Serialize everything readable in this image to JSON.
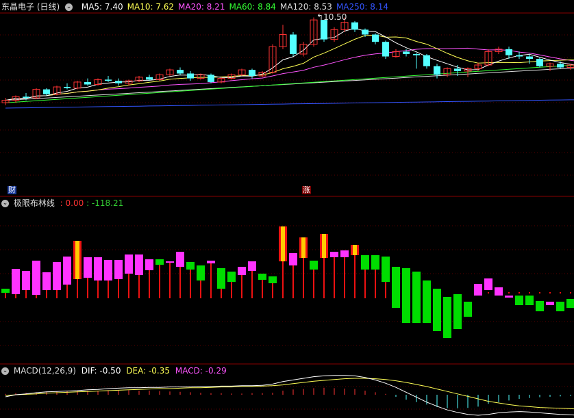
{
  "colors": {
    "background": "#000000",
    "separator": "#8a0000",
    "grid": "#5a0000",
    "up": "#ff3333",
    "down": "#54ffff",
    "ma5": "#ffffff",
    "ma10": "#ffff55",
    "ma20": "#ff55ff",
    "ma60": "#33ff33",
    "ma120": "#dddddd",
    "ma250": "#3355ff",
    "bar_magenta": "#ff33ff",
    "bar_green": "#00dd00",
    "bar_red": "#ee1111",
    "bar_yellow": "#ffcc00",
    "dea": "#ffff55"
  },
  "main_panel": {
    "title": "东晶电子 (日线)",
    "ma": [
      {
        "label": "MA5: 7.40",
        "color": "#ffffff"
      },
      {
        "label": "MA10: 7.62",
        "color": "#ffff55"
      },
      {
        "label": "MA20: 8.21",
        "color": "#ff55ff"
      },
      {
        "label": "MA60: 8.84",
        "color": "#33ff33"
      },
      {
        "label": "MA120: 8.53",
        "color": "#dddddd"
      },
      {
        "label": "MA250: 8.14",
        "color": "#3355ff"
      }
    ],
    "high_marker": "10.50",
    "tag_cai": "财",
    "tag_zhang": "涨"
  },
  "indicator_panel": {
    "name": "极限布林线",
    "value1": ": 0.00",
    "value2": ": -118.21"
  },
  "macd_panel": {
    "name": "MACD(12,26,9)",
    "dif": "DIF: -0.50",
    "dea": "DEA: -0.35",
    "macd": "MACD: -0.29"
  },
  "chart_data": {
    "type": "candlestick",
    "series": [
      {
        "name": "K",
        "values": [
          [
            7.0,
            7.2,
            6.9,
            7.1
          ],
          [
            7.1,
            7.3,
            7.0,
            7.25
          ],
          [
            7.25,
            7.4,
            7.1,
            7.2
          ],
          [
            7.2,
            7.6,
            7.15,
            7.55
          ],
          [
            7.55,
            7.6,
            7.3,
            7.35
          ],
          [
            7.35,
            7.7,
            7.3,
            7.65
          ],
          [
            7.65,
            7.8,
            7.55,
            7.6
          ],
          [
            7.6,
            7.9,
            7.55,
            7.85
          ],
          [
            7.85,
            8.0,
            7.7,
            7.75
          ],
          [
            7.75,
            8.0,
            7.7,
            7.95
          ],
          [
            7.95,
            8.1,
            7.85,
            7.9
          ],
          [
            7.9,
            8.0,
            7.7,
            7.8
          ],
          [
            7.8,
            7.95,
            7.7,
            7.9
          ],
          [
            7.9,
            8.1,
            7.85,
            8.05
          ],
          [
            8.05,
            8.15,
            7.9,
            7.95
          ],
          [
            7.95,
            8.2,
            7.9,
            8.15
          ],
          [
            8.15,
            8.4,
            8.1,
            8.35
          ],
          [
            8.35,
            8.45,
            8.15,
            8.2
          ],
          [
            8.2,
            8.3,
            7.9,
            8.0
          ],
          [
            8.0,
            8.2,
            7.95,
            8.15
          ],
          [
            8.15,
            8.2,
            7.8,
            7.85
          ],
          [
            7.85,
            8.05,
            7.8,
            8.0
          ],
          [
            8.0,
            8.2,
            7.95,
            8.15
          ],
          [
            8.15,
            8.4,
            8.1,
            8.35
          ],
          [
            8.35,
            8.4,
            8.0,
            8.1
          ],
          [
            8.1,
            8.3,
            8.05,
            8.25
          ],
          [
            8.25,
            9.4,
            8.2,
            9.3
          ],
          [
            9.3,
            10.2,
            9.2,
            9.8
          ],
          [
            9.8,
            9.9,
            8.9,
            9.0
          ],
          [
            9.0,
            9.5,
            8.9,
            9.4
          ],
          [
            9.4,
            10.5,
            9.3,
            10.4
          ],
          [
            10.4,
            10.4,
            9.5,
            9.6
          ],
          [
            9.6,
            10.1,
            9.5,
            10.0
          ],
          [
            10.0,
            10.5,
            9.9,
            10.3
          ],
          [
            10.3,
            10.35,
            9.9,
            10.0
          ],
          [
            10.0,
            10.05,
            9.7,
            9.8
          ],
          [
            9.8,
            9.85,
            9.4,
            9.5
          ],
          [
            9.5,
            9.55,
            8.8,
            8.9
          ],
          [
            8.9,
            9.2,
            8.85,
            9.1
          ],
          [
            9.1,
            9.2,
            8.9,
            9.0
          ],
          [
            9.0,
            9.05,
            8.4,
            8.95
          ],
          [
            8.95,
            9.0,
            8.4,
            8.5
          ],
          [
            8.5,
            8.6,
            8.0,
            8.15
          ],
          [
            8.15,
            8.45,
            8.05,
            8.4
          ],
          [
            8.4,
            8.55,
            8.1,
            8.3
          ],
          [
            8.3,
            8.45,
            8.05,
            8.4
          ],
          [
            8.4,
            8.65,
            8.3,
            8.55
          ],
          [
            8.55,
            9.2,
            8.5,
            9.1
          ],
          [
            9.1,
            9.3,
            9.0,
            9.2
          ],
          [
            9.2,
            9.3,
            8.8,
            8.95
          ],
          [
            8.95,
            9.1,
            8.8,
            8.9
          ],
          [
            8.9,
            9.0,
            8.6,
            8.8
          ],
          [
            8.8,
            8.85,
            8.45,
            8.5
          ],
          [
            8.5,
            8.65,
            8.3,
            8.6
          ],
          [
            8.6,
            8.7,
            8.4,
            8.45
          ],
          [
            8.45,
            8.6,
            8.35,
            8.55
          ],
          [
            8.55,
            8.6,
            8.3,
            8.45
          ]
        ]
      }
    ],
    "ylim": [
      6.5,
      10.6
    ],
    "indicator_bars": [
      {
        "c": "g",
        "a": 0.0,
        "b": -0.6
      },
      {
        "c": "m",
        "a": -3.5,
        "b": 0.2
      },
      {
        "c": "m",
        "a": -3.2,
        "b": -0.4
      },
      {
        "c": "m",
        "a": -4.7,
        "b": 0.3
      },
      {
        "c": "m",
        "a": -3.0,
        "b": -0.4
      },
      {
        "c": "m",
        "a": -4.5,
        "b": -0.4
      },
      {
        "c": "m",
        "a": -5.3,
        "b": -1.2
      },
      {
        "c": "y",
        "a": -7.6,
        "b": -2.0
      },
      {
        "c": "m",
        "a": -5.2,
        "b": -2.2
      },
      {
        "c": "m",
        "a": -5.2,
        "b": -1.8
      },
      {
        "c": "m",
        "a": -4.8,
        "b": -1.8
      },
      {
        "c": "m",
        "a": -4.8,
        "b": -2.0
      },
      {
        "c": "m",
        "a": -5.6,
        "b": -2.8
      },
      {
        "c": "m",
        "a": -5.6,
        "b": -2.6
      },
      {
        "c": "m",
        "a": -4.9,
        "b": -3.3
      },
      {
        "c": "g",
        "a": -4.9,
        "b": -4.1
      },
      {
        "c": "m",
        "a": -4.6,
        "b": -4.6
      },
      {
        "c": "m",
        "a": -6.0,
        "b": -3.8
      },
      {
        "c": "g",
        "a": -4.5,
        "b": -3.4
      },
      {
        "c": "g",
        "a": -4.0,
        "b": -1.8
      },
      {
        "c": "m",
        "a": -4.7,
        "b": -4.3
      },
      {
        "c": "g",
        "a": -3.6,
        "b": -0.6
      },
      {
        "c": "g",
        "a": -3.1,
        "b": -1.6
      },
      {
        "c": "m",
        "a": -3.8,
        "b": -2.6
      },
      {
        "c": "m",
        "a": -4.6,
        "b": -3.2
      },
      {
        "c": "g",
        "a": -2.8,
        "b": -1.9
      },
      {
        "c": "g",
        "a": -2.4,
        "b": -1.4
      },
      {
        "c": "y",
        "a": -9.7,
        "b": -4.6
      },
      {
        "c": "m",
        "a": -5.8,
        "b": -4.0
      },
      {
        "c": "y",
        "a": -8.1,
        "b": -5.1
      },
      {
        "c": "g",
        "a": -4.7,
        "b": -3.4
      },
      {
        "c": "y",
        "a": -8.6,
        "b": -5.1
      },
      {
        "c": "m",
        "a": -6.0,
        "b": -5.2
      },
      {
        "c": "m",
        "a": -6.2,
        "b": -5.2
      },
      {
        "c": "y",
        "a": -7.0,
        "b": -5.5
      },
      {
        "c": "g",
        "a": -5.5,
        "b": -3.4
      },
      {
        "c": "g",
        "a": -5.5,
        "b": -3.4
      },
      {
        "c": "g",
        "a": -5.3,
        "b": -1.6
      },
      {
        "c": "g",
        "a": -3.8,
        "b": 2.2
      },
      {
        "c": "g",
        "a": -3.6,
        "b": 4.4
      },
      {
        "c": "g",
        "a": -3.1,
        "b": 4.4
      },
      {
        "c": "g",
        "a": -1.8,
        "b": 4.4
      },
      {
        "c": "g",
        "a": -0.6,
        "b": 5.6
      },
      {
        "c": "g",
        "a": 0.6,
        "b": 6.6
      },
      {
        "c": "g",
        "a": 0.2,
        "b": 5.3
      },
      {
        "c": "g",
        "a": 1.3,
        "b": 3.5
      },
      {
        "c": "m",
        "a": 0.4,
        "b": -1.3
      },
      {
        "c": "m",
        "a": -0.4,
        "b": -2.1
      },
      {
        "c": "m",
        "a": 0.4,
        "b": -0.8
      },
      {
        "c": "m",
        "a": 0.7,
        "b": 0.4
      },
      {
        "c": "g",
        "a": 0.4,
        "b": 1.8
      },
      {
        "c": "g",
        "a": 0.4,
        "b": 1.8
      },
      {
        "c": "g",
        "a": 1.2,
        "b": 2.7
      },
      {
        "c": "m",
        "a": 1.3,
        "b": 1.8
      },
      {
        "c": "g",
        "a": 1.3,
        "b": 2.7
      },
      {
        "c": "g",
        "a": 0.9,
        "b": 2.2
      }
    ],
    "macd_hist": [
      0.02,
      0.04,
      0.05,
      0.06,
      0.08,
      0.08,
      0.09,
      0.1,
      0.1,
      0.1,
      0.11,
      0.11,
      0.11,
      0.1,
      0.1,
      0.09,
      0.08,
      0.07,
      0.06,
      0.05,
      0.04,
      0.04,
      0.03,
      0.03,
      0.04,
      0.04,
      0.05,
      0.1,
      0.13,
      0.14,
      0.16,
      0.17,
      0.16,
      0.15,
      0.14,
      0.1,
      0.06,
      0.02,
      -0.05,
      -0.12,
      -0.18,
      -0.24,
      -0.3,
      -0.33,
      -0.33,
      -0.32,
      -0.29,
      -0.22,
      -0.18,
      -0.14,
      -0.1,
      -0.08,
      -0.06,
      -0.05,
      -0.04,
      -0.03,
      -0.03
    ],
    "dif": [
      -0.05,
      0.0,
      0.02,
      0.05,
      0.07,
      0.08,
      0.09,
      0.1,
      0.12,
      0.13,
      0.15,
      0.16,
      0.17,
      0.17,
      0.18,
      0.18,
      0.19,
      0.19,
      0.19,
      0.2,
      0.2,
      0.21,
      0.21,
      0.22,
      0.22,
      0.23,
      0.26,
      0.32,
      0.36,
      0.4,
      0.44,
      0.46,
      0.47,
      0.47,
      0.46,
      0.42,
      0.36,
      0.28,
      0.18,
      0.06,
      -0.06,
      -0.18,
      -0.28,
      -0.37,
      -0.43,
      -0.48,
      -0.5,
      -0.48,
      -0.44,
      -0.42,
      -0.41,
      -0.42,
      -0.44,
      -0.46,
      -0.48,
      -0.49,
      -0.5
    ],
    "dea": [
      -0.02,
      0.0,
      0.01,
      0.02,
      0.04,
      0.05,
      0.06,
      0.07,
      0.08,
      0.09,
      0.1,
      0.11,
      0.12,
      0.13,
      0.14,
      0.15,
      0.15,
      0.16,
      0.17,
      0.17,
      0.18,
      0.19,
      0.19,
      0.2,
      0.2,
      0.21,
      0.22,
      0.24,
      0.27,
      0.3,
      0.33,
      0.35,
      0.37,
      0.39,
      0.4,
      0.4,
      0.39,
      0.37,
      0.34,
      0.3,
      0.25,
      0.2,
      0.14,
      0.08,
      0.02,
      -0.04,
      -0.1,
      -0.16,
      -0.2,
      -0.24,
      -0.27,
      -0.29,
      -0.31,
      -0.32,
      -0.33,
      -0.34,
      -0.35
    ],
    "macd_ylim": [
      -0.6,
      0.6
    ]
  }
}
